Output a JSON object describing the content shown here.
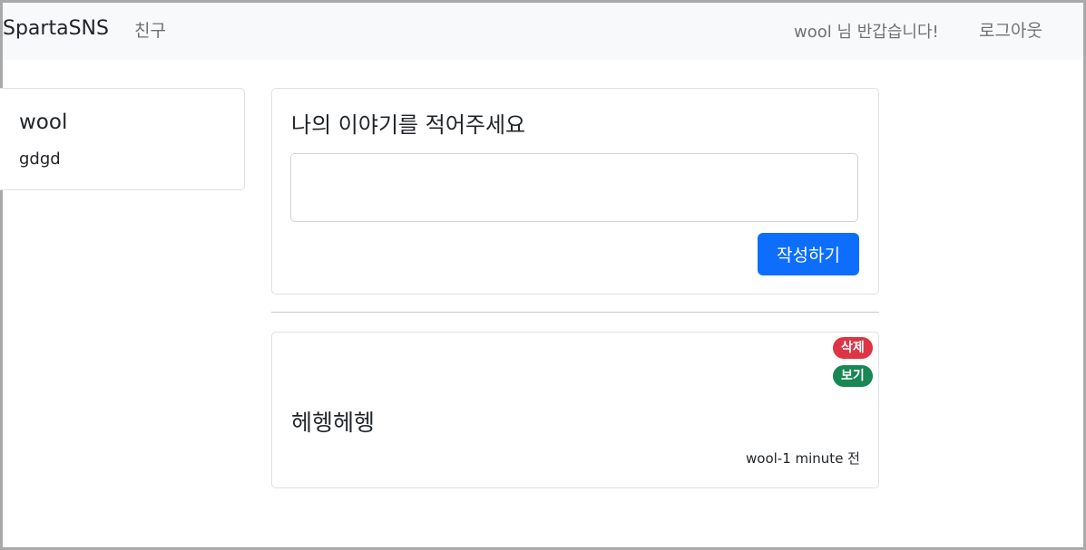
{
  "navbar": {
    "brand": "SpartaSNS",
    "friends_link": "친구",
    "greeting": "wool 님 반갑습니다!",
    "logout_link": "로그아웃"
  },
  "profile": {
    "name": "wool",
    "status": "gdgd"
  },
  "compose": {
    "title": "나의 이야기를 적어주세요",
    "input_value": "",
    "submit_label": "작성하기"
  },
  "posts": [
    {
      "content": "헤헹헤헹",
      "delete_label": "삭제",
      "view_label": "보기",
      "meta": "wool-1 minute 전"
    }
  ],
  "colors": {
    "primary": "#0d6efd",
    "danger": "#dc3545",
    "success": "#198754",
    "navbar_bg": "#f8f9fa"
  }
}
